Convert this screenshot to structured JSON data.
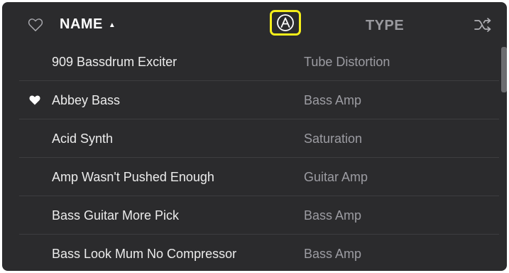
{
  "header": {
    "name_label": "NAME",
    "sort_indicator": "▲",
    "type_label": "TYPE",
    "favorite_icon": "heart-outline-icon",
    "arturia_icon": "arturia-logo-icon",
    "shuffle_icon": "shuffle-icon",
    "highlight_color": "#f5ee1a"
  },
  "presets": [
    {
      "name": "909 Bassdrum Exciter",
      "type": "Tube Distortion",
      "favorite": false
    },
    {
      "name": "Abbey Bass",
      "type": "Bass Amp",
      "favorite": true
    },
    {
      "name": "Acid Synth",
      "type": "Saturation",
      "favorite": false
    },
    {
      "name": "Amp Wasn't Pushed Enough",
      "type": "Guitar Amp",
      "favorite": false
    },
    {
      "name": "Bass Guitar More Pick",
      "type": "Bass Amp",
      "favorite": false
    },
    {
      "name": "Bass Look Mum No Compressor",
      "type": "Bass Amp",
      "favorite": false
    }
  ],
  "colors": {
    "panel_bg": "#2b2b2d",
    "row_text": "#ececec",
    "type_text": "#9c9ca2"
  }
}
